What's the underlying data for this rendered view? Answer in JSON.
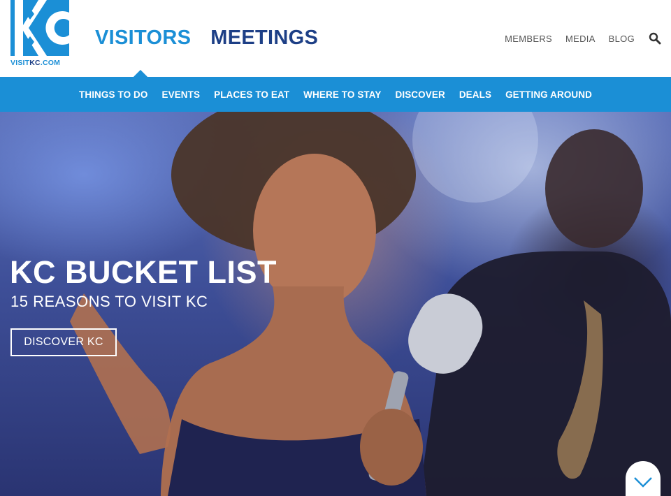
{
  "logo": {
    "mark_letters": "KC",
    "url_prefix": "VISIT",
    "url_highlight": "KC",
    "url_suffix": ".COM",
    "colors": {
      "primary": "#1b8fd6",
      "secondary": "#1d3f86"
    }
  },
  "primary_tabs": [
    {
      "label": "VISITORS",
      "active": true
    },
    {
      "label": "MEETINGS",
      "active": false
    }
  ],
  "utility_nav": [
    {
      "label": "MEMBERS"
    },
    {
      "label": "MEDIA"
    },
    {
      "label": "BLOG"
    }
  ],
  "search": {
    "icon": "search-icon"
  },
  "subnav": [
    {
      "label": "THINGS TO DO"
    },
    {
      "label": "EVENTS"
    },
    {
      "label": "PLACES TO EAT"
    },
    {
      "label": "WHERE TO STAY"
    },
    {
      "label": "DISCOVER"
    },
    {
      "label": "DEALS"
    },
    {
      "label": "GETTING AROUND"
    }
  ],
  "hero": {
    "title": "KC BUCKET LIST",
    "subtitle": "15 REASONS TO VISIT KC",
    "cta_label": "DISCOVER KC",
    "scroll_icon": "chevron-down-icon"
  },
  "colors": {
    "accent": "#1b8fd6",
    "navy": "#1d3f86",
    "text_muted": "#555555"
  }
}
